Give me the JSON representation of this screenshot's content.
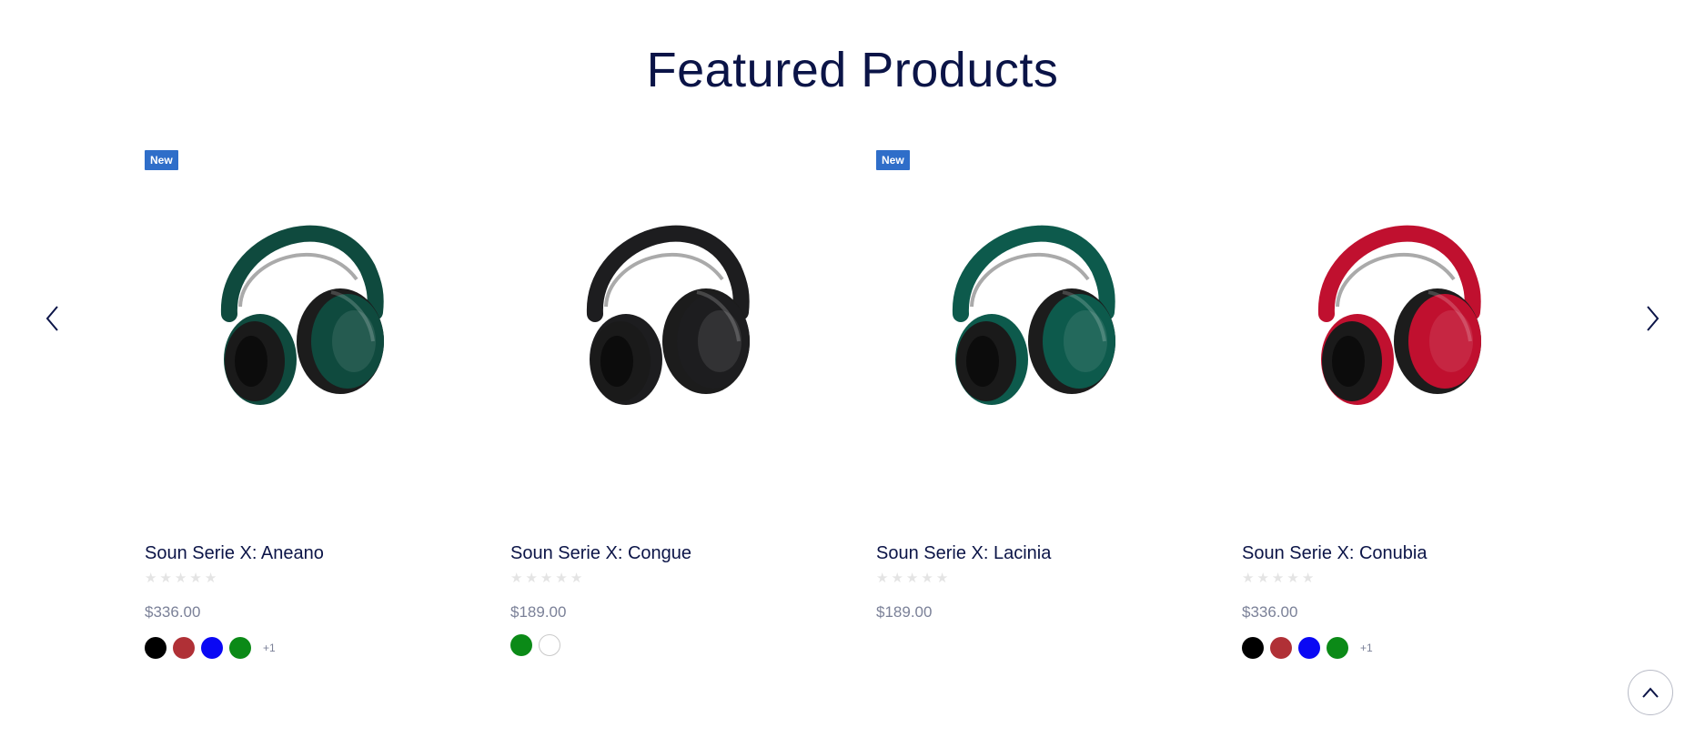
{
  "section": {
    "title": "Featured Products"
  },
  "carousel": {
    "prev_icon": "chevron-left-icon",
    "next_icon": "chevron-right-icon"
  },
  "products": [
    {
      "badge": "New",
      "name": "Soun Serie X: Aneano",
      "price": "$336.00",
      "rating": 0,
      "headphone_color": "#0f4a3e",
      "swatches": [
        "#000000",
        "#b03036",
        "#0a08f4",
        "#0b8a17"
      ],
      "more": "+1"
    },
    {
      "badge": "",
      "name": "Soun Serie X: Congue",
      "price": "$189.00",
      "rating": 0,
      "headphone_color": "#1d1d1f",
      "swatches": [
        "#0b8a17",
        "#ffffff"
      ],
      "more": ""
    },
    {
      "badge": "New",
      "name": "Soun Serie X: Lacinia",
      "price": "$189.00",
      "rating": 0,
      "headphone_color": "#0d5a4c",
      "swatches": [],
      "more": ""
    },
    {
      "badge": "",
      "name": "Soun Serie X: Conubia",
      "price": "$336.00",
      "rating": 0,
      "headphone_color": "#c0102f",
      "swatches": [
        "#000000",
        "#b03036",
        "#0a08f4",
        "#0b8a17"
      ],
      "more": "+1"
    }
  ],
  "back_to_top": {
    "icon": "chevron-up-icon"
  }
}
